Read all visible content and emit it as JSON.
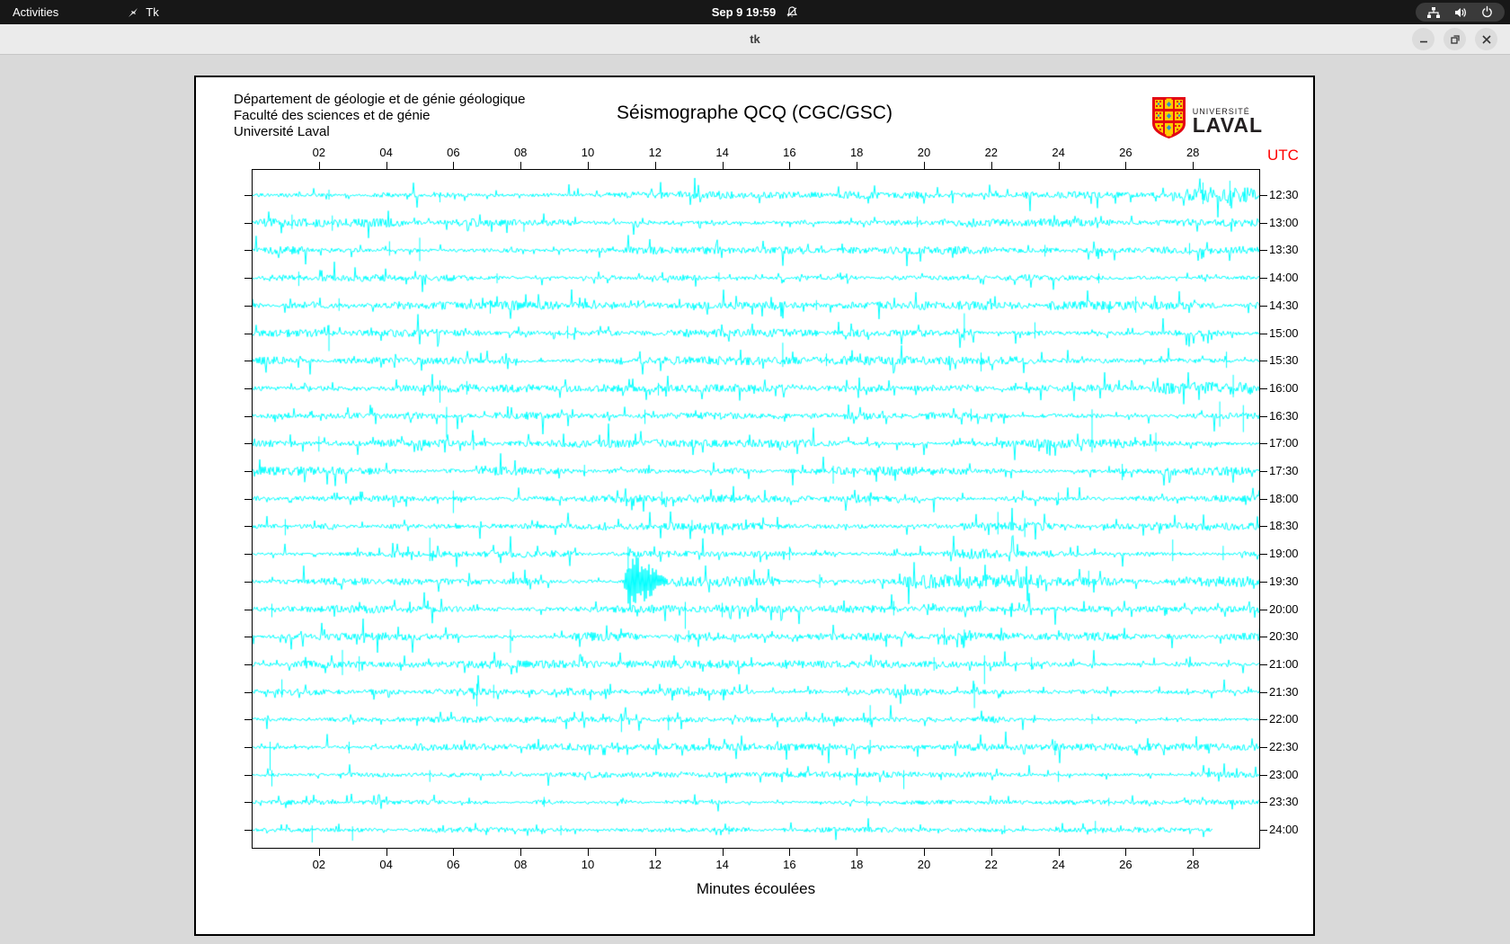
{
  "desktop": {
    "topbar": {
      "activities": "Activities",
      "app_menu": "Tk",
      "clock": "Sep 9 19:59",
      "tray_icons": [
        "network-wired-icon",
        "volume-icon",
        "power-icon"
      ]
    },
    "window": {
      "title": "tk",
      "buttons": [
        "minimize",
        "maximize",
        "close"
      ]
    }
  },
  "figure": {
    "header_lines": {
      "0": "Département de géologie et de génie géologique",
      "1": "Faculté des sciences et de génie",
      "2": "Université Laval"
    },
    "title": "Séismographe QCQ (CGC/GSC)",
    "logo": {
      "top": "UNIVERSITÉ",
      "bottom": "LAVAL"
    }
  },
  "chart_data": {
    "type": "line",
    "title": "Séismographe QCQ (CGC/GSC)",
    "trace_color": "#00ffff",
    "x_axis": {
      "label": "Minutes écoulées",
      "range": [
        0,
        30
      ],
      "ticks": [
        2,
        4,
        6,
        8,
        10,
        12,
        14,
        16,
        18,
        20,
        22,
        24,
        26,
        28
      ],
      "tick_labels": [
        "02",
        "04",
        "06",
        "08",
        "10",
        "12",
        "14",
        "16",
        "18",
        "20",
        "22",
        "24",
        "26",
        "28"
      ]
    },
    "y_axis": {
      "label": "UTC",
      "label_color": "#ff0000"
    },
    "rows": [
      {
        "label": "12:30",
        "base": 2.4,
        "spike": 12,
        "end": 30,
        "bursts": [
          {
            "s": 27.6,
            "e": 30,
            "a": 9
          }
        ],
        "spikes": [
          [
            2.3,
            6,
            5
          ],
          [
            5.6,
            0,
            8
          ],
          [
            28.3,
            14,
            10
          ],
          [
            29.1,
            16,
            12
          ]
        ]
      },
      {
        "label": "13:00",
        "base": 2.6,
        "spike": 12,
        "end": 30,
        "bursts": [
          {
            "s": 0,
            "e": 4.6,
            "a": 5
          }
        ],
        "spikes": [
          [
            1.2,
            9,
            7
          ],
          [
            2.4,
            8,
            9
          ],
          [
            8.1,
            0,
            10
          ],
          [
            19.8,
            7,
            5
          ]
        ]
      },
      {
        "label": "13:30",
        "base": 2.4,
        "spike": 12,
        "end": 30,
        "bursts": [
          {
            "s": 0.3,
            "e": 1.8,
            "a": 4.5
          }
        ],
        "spikes": [
          [
            4.1,
            10,
            6
          ],
          [
            5.0,
            14,
            12
          ],
          [
            23.6,
            6,
            7
          ],
          [
            27.9,
            8,
            5
          ]
        ]
      },
      {
        "label": "14:00",
        "base": 2.2,
        "spike": 10,
        "end": 30,
        "bursts": [],
        "spikes": [
          [
            1.4,
            7,
            9
          ],
          [
            7.3,
            5,
            6
          ],
          [
            13.9,
            6,
            4
          ],
          [
            25.2,
            5,
            6
          ]
        ]
      },
      {
        "label": "14:30",
        "base": 2.8,
        "spike": 12,
        "end": 30,
        "bursts": [
          {
            "s": 23.5,
            "e": 27.5,
            "a": 5
          }
        ],
        "spikes": [
          [
            2.6,
            8,
            6
          ],
          [
            7.1,
            6,
            9
          ],
          [
            16.8,
            6,
            5
          ],
          [
            26.3,
            10,
            8
          ]
        ]
      },
      {
        "label": "15:00",
        "base": 2.5,
        "spike": 12,
        "end": 30,
        "bursts": [
          {
            "s": 20.8,
            "e": 21.6,
            "a": 6
          }
        ],
        "spikes": [
          [
            2.3,
            9,
            20
          ],
          [
            9.4,
            8,
            6
          ],
          [
            21.2,
            22,
            8
          ],
          [
            23.3,
            12,
            6
          ]
        ]
      },
      {
        "label": "15:30",
        "base": 2.7,
        "spike": 12,
        "end": 30,
        "bursts": [
          {
            "s": 0,
            "e": 1.2,
            "a": 5
          }
        ],
        "spikes": [
          [
            15.8,
            20,
            7
          ],
          [
            17.1,
            8,
            6
          ],
          [
            21.7,
            9,
            12
          ],
          [
            29.0,
            10,
            8
          ]
        ]
      },
      {
        "label": "16:00",
        "base": 2.5,
        "spike": 12,
        "end": 30,
        "bursts": [
          {
            "s": 26.8,
            "e": 30,
            "a": 7
          }
        ],
        "spikes": [
          [
            5.6,
            9,
            16
          ],
          [
            6.4,
            8,
            7
          ],
          [
            12.1,
            6,
            8
          ],
          [
            29.2,
            15,
            10
          ]
        ]
      },
      {
        "label": "16:30",
        "base": 2.4,
        "spike": 12,
        "end": 30,
        "bursts": [],
        "spikes": [
          [
            5.8,
            10,
            24
          ],
          [
            11.7,
            7,
            9
          ],
          [
            21.4,
            8,
            6
          ],
          [
            28.8,
            16,
            12
          ],
          [
            29.5,
            12,
            18
          ]
        ]
      },
      {
        "label": "17:00",
        "base": 2.6,
        "spike": 13,
        "end": 30,
        "bursts": [
          {
            "s": 23.8,
            "e": 26.2,
            "a": 5
          }
        ],
        "spikes": [
          [
            2.0,
            8,
            9
          ],
          [
            6.6,
            9,
            7
          ],
          [
            25.0,
            38,
            10
          ],
          [
            26.9,
            12,
            9
          ]
        ]
      },
      {
        "label": "17:30",
        "base": 2.8,
        "spike": 12,
        "end": 30,
        "bursts": [
          {
            "s": 0,
            "e": 3.2,
            "a": 5
          }
        ],
        "spikes": [
          [
            9.9,
            7,
            6
          ],
          [
            17.3,
            6,
            14
          ],
          [
            25.9,
            8,
            10
          ]
        ]
      },
      {
        "label": "18:00",
        "base": 2.5,
        "spike": 12,
        "end": 30,
        "bursts": [],
        "spikes": [
          [
            6.0,
            9,
            16
          ],
          [
            12.2,
            8,
            7
          ],
          [
            18.4,
            6,
            8
          ],
          [
            24.0,
            7,
            6
          ]
        ]
      },
      {
        "label": "18:30",
        "base": 2.6,
        "spike": 12,
        "end": 30,
        "bursts": [
          {
            "s": 21.0,
            "e": 24.0,
            "a": 5
          }
        ],
        "spikes": [
          [
            1.0,
            8,
            10
          ],
          [
            13.1,
            7,
            6
          ],
          [
            22.2,
            16,
            9
          ],
          [
            23.0,
            9,
            12
          ]
        ]
      },
      {
        "label": "19:00",
        "base": 2.6,
        "spike": 13,
        "end": 30,
        "bursts": [
          {
            "s": 20.8,
            "e": 22.3,
            "a": 6
          }
        ],
        "spikes": [
          [
            5.3,
            18,
            8
          ],
          [
            11.2,
            8,
            20
          ],
          [
            16.0,
            8,
            7
          ],
          [
            27.4,
            16,
            8
          ],
          [
            28.9,
            9,
            7
          ]
        ]
      },
      {
        "label": "19:30",
        "base": 2.8,
        "spike": 12,
        "end": 30,
        "bursts": [
          {
            "s": 11.05,
            "e": 12.4,
            "a": 34,
            "osc": true
          },
          {
            "s": 12.4,
            "e": 15.8,
            "a": 6
          },
          {
            "s": 19.3,
            "e": 23.7,
            "a": 8
          },
          {
            "s": 27.5,
            "e": 30,
            "a": 6
          }
        ],
        "spikes": [
          [
            16.9,
            8,
            7
          ],
          [
            24.9,
            12,
            6
          ]
        ]
      },
      {
        "label": "20:00",
        "base": 2.5,
        "spike": 12,
        "end": 30,
        "bursts": [
          {
            "s": 10.6,
            "e": 12.8,
            "a": 4.5
          }
        ],
        "spikes": [
          [
            0.6,
            6,
            9
          ],
          [
            12.9,
            8,
            22
          ],
          [
            14.0,
            7,
            9
          ],
          [
            19.1,
            9,
            7
          ],
          [
            22.6,
            6,
            8
          ]
        ]
      },
      {
        "label": "20:30",
        "base": 2.6,
        "spike": 12,
        "end": 30,
        "bursts": [
          {
            "s": 9.4,
            "e": 11.6,
            "a": 5
          }
        ],
        "spikes": [
          [
            7.7,
            8,
            18
          ],
          [
            13.0,
            7,
            6
          ],
          [
            20.6,
            10,
            9
          ],
          [
            21.2,
            8,
            11
          ]
        ]
      },
      {
        "label": "21:00",
        "base": 2.6,
        "spike": 12,
        "end": 30,
        "bursts": [
          {
            "s": 15.6,
            "e": 16.6,
            "a": 5
          }
        ],
        "spikes": [
          [
            2.7,
            16,
            12
          ],
          [
            3.2,
            9,
            8
          ],
          [
            20.3,
            8,
            7
          ],
          [
            21.8,
            10,
            22
          ],
          [
            23.2,
            8,
            6
          ]
        ]
      },
      {
        "label": "21:30",
        "base": 2.5,
        "spike": 12,
        "end": 30,
        "bursts": [],
        "spikes": [
          [
            0.9,
            14,
            6
          ],
          [
            6.7,
            9,
            16
          ],
          [
            7.2,
            8,
            7
          ],
          [
            13.0,
            6,
            5
          ],
          [
            21.5,
            9,
            18
          ]
        ]
      },
      {
        "label": "22:00",
        "base": 2.0,
        "spike": 10,
        "end": 30,
        "bursts": [],
        "spikes": [
          [
            11.0,
            6,
            14
          ],
          [
            12.4,
            5,
            12
          ],
          [
            18.4,
            16,
            6
          ],
          [
            25.0,
            6,
            5
          ]
        ]
      },
      {
        "label": "22:30",
        "base": 2.3,
        "spike": 11,
        "end": 30,
        "bursts": [
          {
            "s": 13.6,
            "e": 15.2,
            "a": 4.5
          },
          {
            "s": 26.3,
            "e": 28.0,
            "a": 4.5
          }
        ],
        "spikes": [
          [
            0.55,
            6,
            26
          ],
          [
            2.9,
            6,
            7
          ],
          [
            18.4,
            8,
            6
          ],
          [
            23.9,
            7,
            9
          ]
        ]
      },
      {
        "label": "23:00",
        "base": 1.8,
        "spike": 9,
        "end": 30,
        "bursts": [],
        "spikes": [
          [
            0.6,
            5,
            13
          ],
          [
            5.3,
            5,
            8
          ],
          [
            17.5,
            4,
            6
          ],
          [
            19.4,
            5,
            16
          ],
          [
            24.0,
            4,
            8
          ]
        ]
      },
      {
        "label": "23:30",
        "base": 1.6,
        "spike": 8,
        "end": 30,
        "bursts": [
          {
            "s": 8.3,
            "e": 9.2,
            "a": 3
          }
        ],
        "spikes": [
          [
            8.7,
            6,
            5
          ],
          [
            18.3,
            7,
            4
          ],
          [
            25.5,
            5,
            4
          ]
        ]
      },
      {
        "label": "24:00",
        "base": 1.7,
        "spike": 8,
        "end": 28.6,
        "bursts": [],
        "spikes": [
          [
            1.8,
            5,
            14
          ],
          [
            3.0,
            4,
            12
          ],
          [
            9.2,
            5,
            6
          ],
          [
            14.2,
            4,
            5
          ],
          [
            22.4,
            5,
            4
          ],
          [
            25.1,
            10,
            4
          ]
        ]
      }
    ]
  }
}
